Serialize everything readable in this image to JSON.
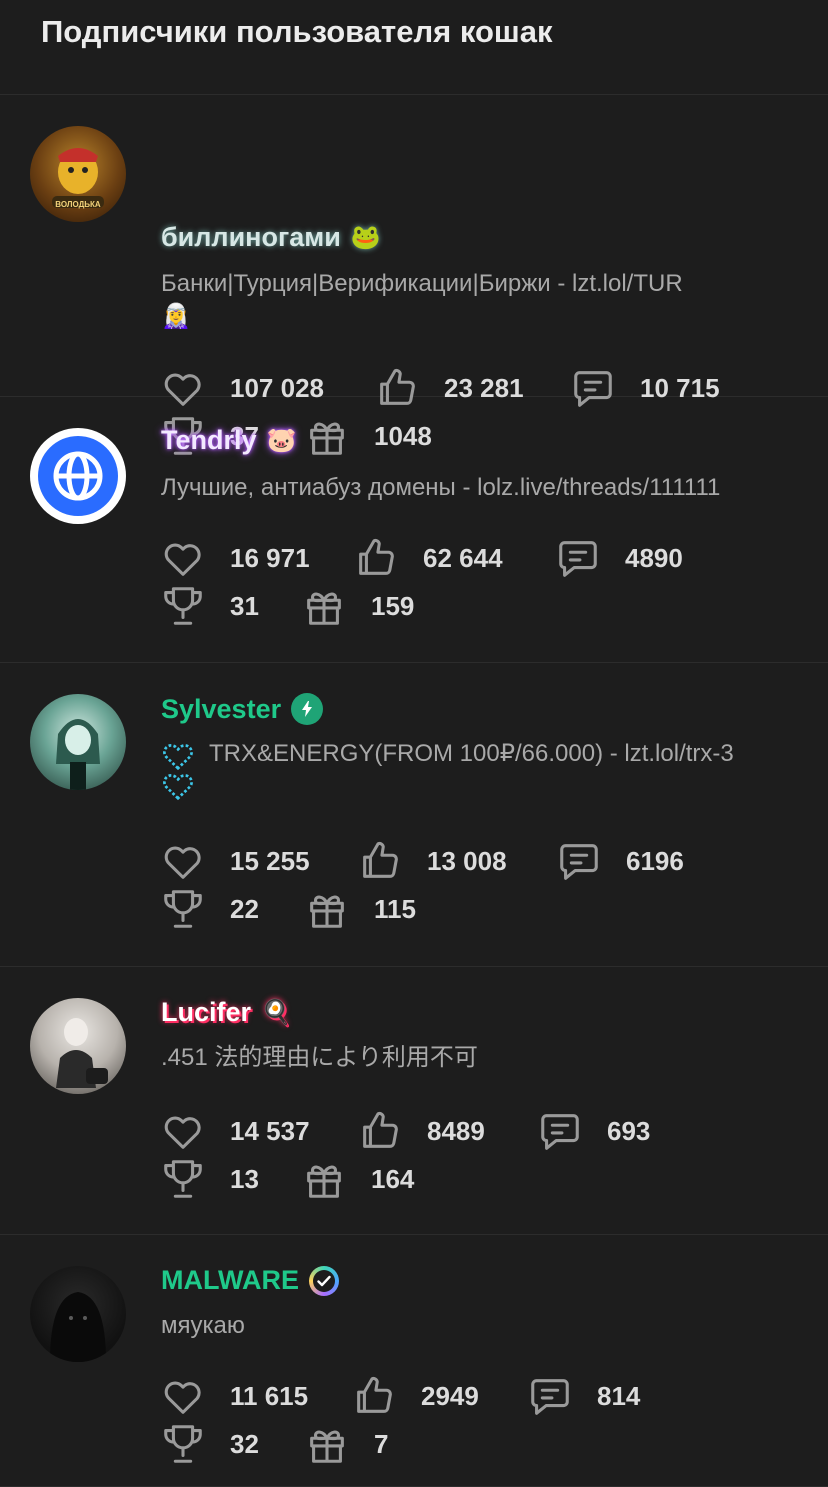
{
  "page": {
    "title": "Подписчики пользователя кошак"
  },
  "users": [
    {
      "name": "биллиногами",
      "name_emoji": "🐸",
      "status": "Банки|Турция|Верификации|Биржи - lzt.lol/TUR",
      "status_extra": "🧝‍♀️",
      "likes": "107 028",
      "thumbs": "23 281",
      "messages": "10 715",
      "trophies": "37",
      "gifts": "1048",
      "avatar_label": "ВОЛОДЬКА"
    },
    {
      "name": "Tendrly",
      "name_emoji": "🐷",
      "status": "Лучшие, антиабуз домены - lolz.live/threads/111111",
      "likes": "16 971",
      "thumbs": "62 644",
      "messages": "4890",
      "trophies": "31",
      "gifts": "159"
    },
    {
      "name": "Sylvester",
      "status": "TRX&ENERGY(FROM 100₽/66.000) - lzt.lol/trx-3",
      "likes": "15 255",
      "thumbs": "13 008",
      "messages": "6196",
      "trophies": "22",
      "gifts": "115"
    },
    {
      "name": "Lucifer",
      "name_emoji": "🍳",
      "status": ".451 法的理由により利用不可",
      "likes": "14 537",
      "thumbs": "8489",
      "messages": "693",
      "trophies": "13",
      "gifts": "164"
    },
    {
      "name": "MALWARE",
      "status": "мяукаю",
      "likes": "11 615",
      "thumbs": "2949",
      "messages": "814",
      "trophies": "32",
      "gifts": "7"
    }
  ],
  "colors": {
    "background": "#1d1d1d",
    "green_name": "#1fc98a",
    "tendrly_glow": "#b45cff",
    "lucifer_glow": "#ff3b6b"
  }
}
